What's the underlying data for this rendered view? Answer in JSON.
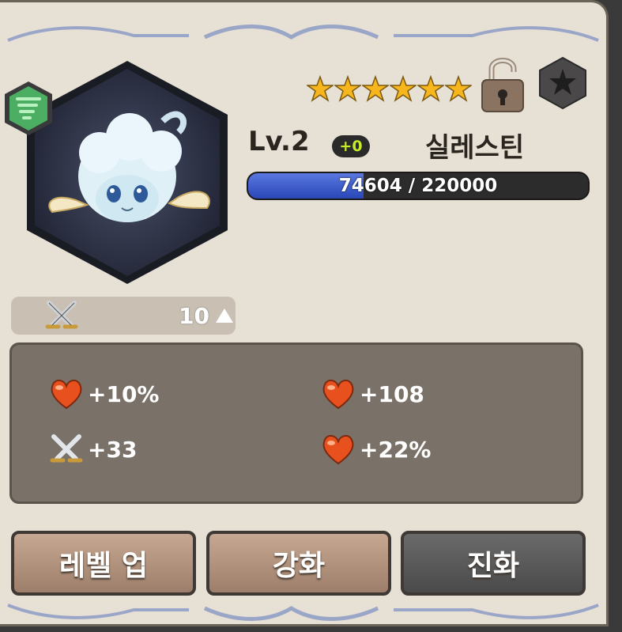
{
  "character": {
    "level": "Lv.2",
    "plus": "+0",
    "name": "실레스틴",
    "star_count": 6,
    "exp_text": "74604 / 220000",
    "exp_fraction": 0.339
  },
  "power": {
    "value": "10",
    "icon": "crossed-swords-icon"
  },
  "stats": [
    {
      "icon": "heart-icon",
      "value": "+10%"
    },
    {
      "icon": "heart-icon",
      "value": "+108"
    },
    {
      "icon": "crossed-swords-icon",
      "value": "+33"
    },
    {
      "icon": "heart-icon",
      "value": "+22%"
    }
  ],
  "buttons": {
    "level_up": "레벨 업",
    "enhance": "강화",
    "evolve": "진화"
  },
  "colors": {
    "panel_bg": "#e7e0d4",
    "exp_fill": "#3a58c8",
    "plus_text": "#c5ec2a",
    "star": "#f7b51e",
    "stats_bg": "#7a7168"
  }
}
